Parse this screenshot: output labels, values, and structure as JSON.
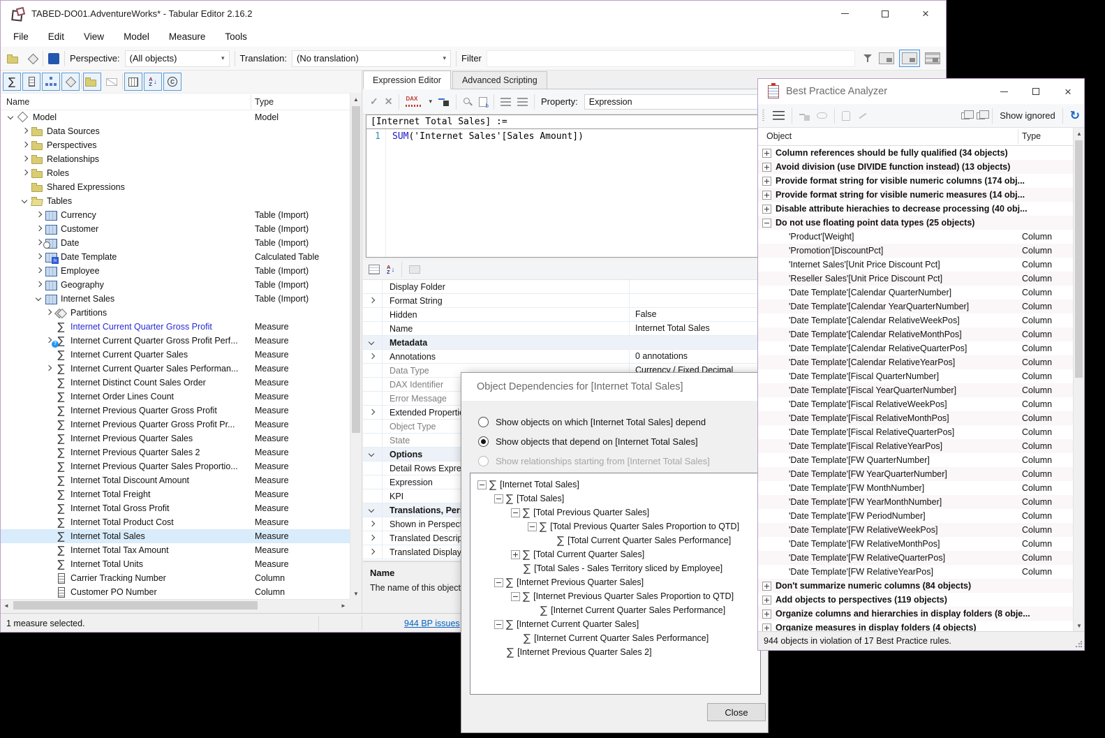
{
  "icons": {
    "sigma": "∑",
    "refresh": "↻",
    "check": "✓",
    "cross": "✕",
    "up": "▲",
    "down": "▼",
    "left": "◄",
    "right": "►",
    "dropdown": "▾"
  },
  "colors": {
    "accent_border": "#b9a0c9",
    "selection": "#d9ecfb",
    "link_blue": "#0563c1",
    "measure_blue": "#2a2ad4",
    "dax_keyword": "#1a16c9",
    "line_number_blue": "#2b91af"
  },
  "main_window": {
    "title": "TABED-DO01.AdventureWorks* - Tabular Editor 2.16.2",
    "menus": [
      "File",
      "Edit",
      "View",
      "Model",
      "Measure",
      "Tools"
    ],
    "toolbar": {
      "perspective_label": "Perspective:",
      "perspective_value": "(All objects)",
      "translation_label": "Translation:",
      "translation_value": "(No translation)",
      "filter_label": "Filter"
    },
    "tree": {
      "columns": [
        "Name",
        "Type"
      ],
      "rows": [
        {
          "indent": 0,
          "exp": "down",
          "icon": "cube",
          "label": "Model",
          "type": "Model"
        },
        {
          "indent": 1,
          "exp": "right",
          "icon": "folder",
          "label": "Data Sources",
          "type": ""
        },
        {
          "indent": 1,
          "exp": "right",
          "icon": "folder",
          "label": "Perspectives",
          "type": ""
        },
        {
          "indent": 1,
          "exp": "right",
          "icon": "folder",
          "label": "Relationships",
          "type": ""
        },
        {
          "indent": 1,
          "exp": "right",
          "icon": "folder",
          "label": "Roles",
          "type": ""
        },
        {
          "indent": 1,
          "exp": "none",
          "icon": "folder",
          "label": "Shared Expressions",
          "type": ""
        },
        {
          "indent": 1,
          "exp": "down",
          "icon": "folder-open",
          "label": "Tables",
          "type": ""
        },
        {
          "indent": 2,
          "exp": "right",
          "icon": "table",
          "label": "Currency",
          "type": "Table (Import)"
        },
        {
          "indent": 2,
          "exp": "right",
          "icon": "table",
          "label": "Customer",
          "type": "Table (Import)"
        },
        {
          "indent": 2,
          "exp": "right",
          "icon": "table-clock",
          "label": "Date",
          "type": "Table (Import)"
        },
        {
          "indent": 2,
          "exp": "right",
          "icon": "table-fx",
          "label": "Date Template",
          "type": "Calculated Table"
        },
        {
          "indent": 2,
          "exp": "right",
          "icon": "table",
          "label": "Employee",
          "type": "Table (Import)"
        },
        {
          "indent": 2,
          "exp": "right",
          "icon": "table",
          "label": "Geography",
          "type": "Table (Import)"
        },
        {
          "indent": 2,
          "exp": "down",
          "icon": "table",
          "label": "Internet Sales",
          "type": "Table (Import)"
        },
        {
          "indent": 3,
          "exp": "right",
          "icon": "partitions",
          "label": "Partitions",
          "type": ""
        },
        {
          "indent": 3,
          "exp": "none",
          "icon": "sigma",
          "label": "Internet Current Quarter Gross Profit",
          "type": "Measure",
          "blue": true
        },
        {
          "indent": 3,
          "exp": "right",
          "icon": "sigma-kpi",
          "label": "Internet Current Quarter Gross Profit Perf...",
          "type": "Measure"
        },
        {
          "indent": 3,
          "exp": "none",
          "icon": "sigma",
          "label": "Internet Current Quarter Sales",
          "type": "Measure"
        },
        {
          "indent": 3,
          "exp": "right",
          "icon": "sigma",
          "label": "Internet Current Quarter Sales Performan...",
          "type": "Measure"
        },
        {
          "indent": 3,
          "exp": "none",
          "icon": "sigma",
          "label": "Internet Distinct Count Sales Order",
          "type": "Measure"
        },
        {
          "indent": 3,
          "exp": "none",
          "icon": "sigma",
          "label": "Internet Order Lines Count",
          "type": "Measure"
        },
        {
          "indent": 3,
          "exp": "none",
          "icon": "sigma",
          "label": "Internet Previous Quarter Gross Profit",
          "type": "Measure"
        },
        {
          "indent": 3,
          "exp": "none",
          "icon": "sigma",
          "label": "Internet Previous Quarter Gross Profit Pr...",
          "type": "Measure"
        },
        {
          "indent": 3,
          "exp": "none",
          "icon": "sigma",
          "label": "Internet Previous Quarter Sales",
          "type": "Measure"
        },
        {
          "indent": 3,
          "exp": "none",
          "icon": "sigma",
          "label": "Internet Previous Quarter Sales 2",
          "type": "Measure"
        },
        {
          "indent": 3,
          "exp": "none",
          "icon": "sigma",
          "label": "Internet Previous Quarter Sales Proportio...",
          "type": "Measure"
        },
        {
          "indent": 3,
          "exp": "none",
          "icon": "sigma",
          "label": "Internet Total Discount Amount",
          "type": "Measure"
        },
        {
          "indent": 3,
          "exp": "none",
          "icon": "sigma",
          "label": "Internet Total Freight",
          "type": "Measure"
        },
        {
          "indent": 3,
          "exp": "none",
          "icon": "sigma",
          "label": "Internet Total Gross Profit",
          "type": "Measure"
        },
        {
          "indent": 3,
          "exp": "none",
          "icon": "sigma",
          "label": "Internet Total Product Cost",
          "type": "Measure"
        },
        {
          "indent": 3,
          "exp": "none",
          "icon": "sigma",
          "label": "Internet Total Sales",
          "type": "Measure",
          "selected": true
        },
        {
          "indent": 3,
          "exp": "none",
          "icon": "sigma",
          "label": "Internet Total Tax Amount",
          "type": "Measure"
        },
        {
          "indent": 3,
          "exp": "none",
          "icon": "sigma",
          "label": "Internet Total Units",
          "type": "Measure"
        },
        {
          "indent": 3,
          "exp": "none",
          "icon": "column",
          "label": "Carrier Tracking Number",
          "type": "Column"
        },
        {
          "indent": 3,
          "exp": "none",
          "icon": "column",
          "label": "Customer PO Number",
          "type": "Column"
        }
      ]
    },
    "status": {
      "selection": "1 measure selected.",
      "bp_link": "944 BP issues"
    }
  },
  "editor": {
    "tabs": [
      {
        "label": "Expression Editor"
      },
      {
        "label": "Advanced Scripting"
      }
    ],
    "toolbar": {
      "dax_icon_label": "DAX",
      "property_label": "Property:",
      "property_value": "Expression"
    },
    "code_header": "[Internet Total Sales] :=",
    "code": {
      "line_number": "1",
      "keyword": "SUM",
      "rest": "('Internet Sales'[Sales Amount])"
    },
    "properties": [
      {
        "gut": "none",
        "label": "Display Folder",
        "value": ""
      },
      {
        "gut": "right",
        "label": "Format String",
        "value": ""
      },
      {
        "gut": "none",
        "label": "Hidden",
        "value": "False"
      },
      {
        "gut": "none",
        "label": "Name",
        "value": "Internet Total Sales"
      },
      {
        "gut": "down",
        "label": "Metadata",
        "category": true
      },
      {
        "gut": "right",
        "label": "Annotations",
        "value": "0 annotations"
      },
      {
        "gut": "none",
        "label": "Data Type",
        "value": "Currency / Fixed Decimal",
        "gray": true
      },
      {
        "gut": "none",
        "label": "DAX Identifier",
        "value": "",
        "gray": true
      },
      {
        "gut": "none",
        "label": "Error Message",
        "value": "",
        "gray": true
      },
      {
        "gut": "right",
        "label": "Extended Properties",
        "value": ""
      },
      {
        "gut": "none",
        "label": "Object Type",
        "value": "",
        "gray": true
      },
      {
        "gut": "none",
        "label": "State",
        "value": "",
        "gray": true
      },
      {
        "gut": "down",
        "label": "Options",
        "category": true
      },
      {
        "gut": "none",
        "label": "Detail Rows Expression",
        "value": ""
      },
      {
        "gut": "none",
        "label": "Expression",
        "value": ""
      },
      {
        "gut": "none",
        "label": "KPI",
        "value": ""
      },
      {
        "gut": "down",
        "label": "Translations, Perspectives, Security",
        "category": true
      },
      {
        "gut": "right",
        "label": "Shown in Perspectives",
        "value": ""
      },
      {
        "gut": "right",
        "label": "Translated Descriptions",
        "value": ""
      },
      {
        "gut": "right",
        "label": "Translated Display Folders",
        "value": ""
      }
    ],
    "help": {
      "title": "Name",
      "text": "The name of this object."
    }
  },
  "dependency_dialog": {
    "title": "Object Dependencies for [Internet Total Sales]",
    "radios": [
      {
        "label": "Show objects on which [Internet Total Sales] depend",
        "state": "off"
      },
      {
        "label": "Show objects that depend on [Internet Total Sales]",
        "state": "on"
      },
      {
        "label": "Show relationships starting from [Internet Total Sales]",
        "state": "disabled"
      }
    ],
    "tree": [
      {
        "level": 0,
        "pm": "minus",
        "label": "[Internet Total Sales]"
      },
      {
        "level": 1,
        "pm": "minus",
        "label": "[Total Sales]"
      },
      {
        "level": 2,
        "pm": "minus",
        "label": "[Total Previous Quarter Sales]"
      },
      {
        "level": 3,
        "pm": "minus",
        "label": "[Total Previous Quarter Sales Proportion to QTD]"
      },
      {
        "level": 4,
        "pm": "none",
        "label": "[Total Current Quarter Sales Performance]"
      },
      {
        "level": 2,
        "pm": "plus",
        "label": "[Total Current Quarter Sales]"
      },
      {
        "level": 2,
        "pm": "none",
        "label": "[Total Sales - Sales Territory sliced by Employee]"
      },
      {
        "level": 1,
        "pm": "minus",
        "label": "[Internet Previous Quarter Sales]"
      },
      {
        "level": 2,
        "pm": "minus",
        "label": "[Internet Previous Quarter Sales Proportion to QTD]"
      },
      {
        "level": 3,
        "pm": "none",
        "label": "[Internet Current Quarter Sales Performance]"
      },
      {
        "level": 1,
        "pm": "minus",
        "label": "[Internet Current Quarter Sales]"
      },
      {
        "level": 2,
        "pm": "none",
        "label": "[Internet Current Quarter Sales Performance]"
      },
      {
        "level": 1,
        "pm": "none",
        "label": "[Internet Previous Quarter Sales 2]"
      }
    ],
    "close_label": "Close"
  },
  "bpa": {
    "title": "Best Practice Analyzer",
    "toolbar": {
      "show_ignored": "Show ignored"
    },
    "columns": [
      "Object",
      "Type"
    ],
    "rows": [
      {
        "kind": "rule",
        "pm": "plus",
        "label": "Column references should be fully qualified (34 objects)"
      },
      {
        "kind": "rule",
        "pm": "plus",
        "label": "Avoid division (use DIVIDE function instead) (13 objects)"
      },
      {
        "kind": "rule",
        "pm": "plus",
        "label": "Provide format string for visible numeric columns (174 obj..."
      },
      {
        "kind": "rule",
        "pm": "plus",
        "label": "Provide format string for visible numeric measures (14 obj..."
      },
      {
        "kind": "rule",
        "pm": "plus",
        "label": "Disable attribute hierachies to decrease processing (40 obj..."
      },
      {
        "kind": "rule",
        "pm": "minus",
        "label": "Do not use floating point data types (25 objects)"
      },
      {
        "kind": "item",
        "label": "'Product'[Weight]",
        "type": "Column"
      },
      {
        "kind": "item",
        "label": "'Promotion'[DiscountPct]",
        "type": "Column"
      },
      {
        "kind": "item",
        "label": "'Internet Sales'[Unit Price Discount Pct]",
        "type": "Column"
      },
      {
        "kind": "item",
        "label": "'Reseller Sales'[Unit Price Discount Pct]",
        "type": "Column"
      },
      {
        "kind": "item",
        "label": "'Date Template'[Calendar QuarterNumber]",
        "type": "Column"
      },
      {
        "kind": "item",
        "label": "'Date Template'[Calendar YearQuarterNumber]",
        "type": "Column"
      },
      {
        "kind": "item",
        "label": "'Date Template'[Calendar RelativeWeekPos]",
        "type": "Column"
      },
      {
        "kind": "item",
        "label": "'Date Template'[Calendar RelativeMonthPos]",
        "type": "Column"
      },
      {
        "kind": "item",
        "label": "'Date Template'[Calendar RelativeQuarterPos]",
        "type": "Column"
      },
      {
        "kind": "item",
        "label": "'Date Template'[Calendar RelativeYearPos]",
        "type": "Column"
      },
      {
        "kind": "item",
        "label": "'Date Template'[Fiscal QuarterNumber]",
        "type": "Column"
      },
      {
        "kind": "item",
        "label": "'Date Template'[Fiscal YearQuarterNumber]",
        "type": "Column"
      },
      {
        "kind": "item",
        "label": "'Date Template'[Fiscal RelativeWeekPos]",
        "type": "Column"
      },
      {
        "kind": "item",
        "label": "'Date Template'[Fiscal RelativeMonthPos]",
        "type": "Column"
      },
      {
        "kind": "item",
        "label": "'Date Template'[Fiscal RelativeQuarterPos]",
        "type": "Column"
      },
      {
        "kind": "item",
        "label": "'Date Template'[Fiscal RelativeYearPos]",
        "type": "Column"
      },
      {
        "kind": "item",
        "label": "'Date Template'[FW QuarterNumber]",
        "type": "Column"
      },
      {
        "kind": "item",
        "label": "'Date Template'[FW YearQuarterNumber]",
        "type": "Column"
      },
      {
        "kind": "item",
        "label": "'Date Template'[FW MonthNumber]",
        "type": "Column"
      },
      {
        "kind": "item",
        "label": "'Date Template'[FW YearMonthNumber]",
        "type": "Column"
      },
      {
        "kind": "item",
        "label": "'Date Template'[FW PeriodNumber]",
        "type": "Column"
      },
      {
        "kind": "item",
        "label": "'Date Template'[FW RelativeWeekPos]",
        "type": "Column"
      },
      {
        "kind": "item",
        "label": "'Date Template'[FW RelativeMonthPos]",
        "type": "Column"
      },
      {
        "kind": "item",
        "label": "'Date Template'[FW RelativeQuarterPos]",
        "type": "Column"
      },
      {
        "kind": "item",
        "label": "'Date Template'[FW RelativeYearPos]",
        "type": "Column"
      },
      {
        "kind": "rule",
        "pm": "plus",
        "label": "Don't summarize numeric columns (84 objects)"
      },
      {
        "kind": "rule",
        "pm": "plus",
        "label": "Add objects to perspectives (119 objects)"
      },
      {
        "kind": "rule",
        "pm": "plus",
        "label": "Organize columns and hierarchies in display folders (8 obje..."
      },
      {
        "kind": "rule",
        "pm": "plus",
        "label": "Organize measures in display folders (4 objects)"
      }
    ],
    "status": "944 objects in violation of 17 Best Practice rules."
  }
}
